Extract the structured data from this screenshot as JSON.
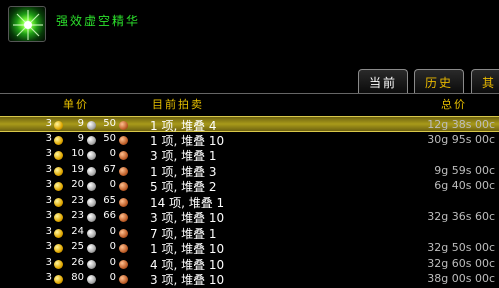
{
  "item": {
    "name": "强效虚空精华",
    "icon": "void-essence-icon"
  },
  "tabs": [
    {
      "label": "当前",
      "active": true
    },
    {
      "label": "历史",
      "active": false
    },
    {
      "label": "其",
      "active": false
    }
  ],
  "columns": {
    "unit_price": "单价",
    "current_auctions": "目前拍卖",
    "total_price": "总价"
  },
  "rows": [
    {
      "g": "3",
      "s": "9",
      "c": "50",
      "qty": "1 项, 堆叠 4",
      "total": "12g 38s 00c",
      "selected": true
    },
    {
      "g": "3",
      "s": "9",
      "c": "50",
      "qty": "1 项, 堆叠 10",
      "total": "30g 95s 00c",
      "selected": false
    },
    {
      "g": "3",
      "s": "10",
      "c": "0",
      "qty": "3 项, 堆叠 1",
      "total": "",
      "selected": false
    },
    {
      "g": "3",
      "s": "19",
      "c": "67",
      "qty": "1 项, 堆叠 3",
      "total": "9g 59s 00c",
      "selected": false
    },
    {
      "g": "3",
      "s": "20",
      "c": "0",
      "qty": "5 项, 堆叠 2",
      "total": "6g 40s 00c",
      "selected": false
    },
    {
      "g": "3",
      "s": "23",
      "c": "65",
      "qty": "14 项, 堆叠 1",
      "total": "",
      "selected": false
    },
    {
      "g": "3",
      "s": "23",
      "c": "66",
      "qty": "3 项, 堆叠 10",
      "total": "32g 36s 60c",
      "selected": false
    },
    {
      "g": "3",
      "s": "24",
      "c": "0",
      "qty": "7 项, 堆叠 1",
      "total": "",
      "selected": false
    },
    {
      "g": "3",
      "s": "25",
      "c": "0",
      "qty": "1 项, 堆叠 10",
      "total": "32g 50s 00c",
      "selected": false
    },
    {
      "g": "3",
      "s": "26",
      "c": "0",
      "qty": "4 项, 堆叠 10",
      "total": "32g 60s 00c",
      "selected": false
    },
    {
      "g": "3",
      "s": "80",
      "c": "0",
      "qty": "3 项, 堆叠 10",
      "total": "38g 00s 00c",
      "selected": false
    }
  ]
}
